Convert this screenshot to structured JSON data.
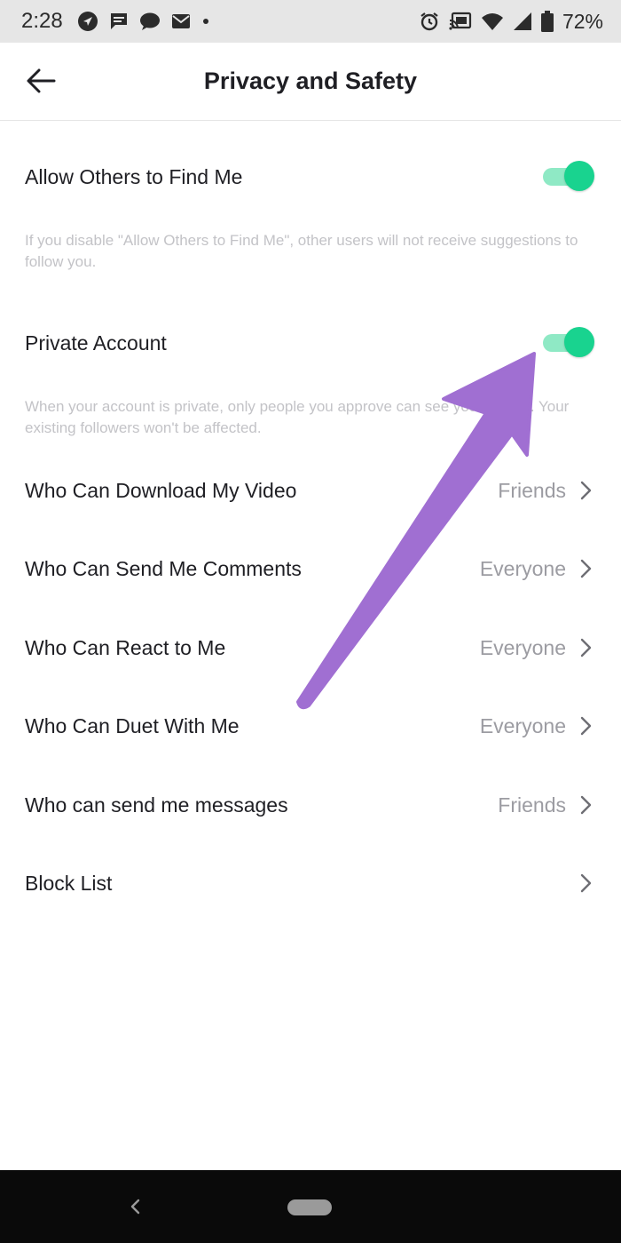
{
  "status_bar": {
    "time": "2:28",
    "battery_percent": "72%",
    "left_icons": [
      "navigation-icon",
      "message-icon",
      "chat-icon",
      "mail-icon",
      "dot-icon"
    ],
    "right_icons": [
      "alarm-icon",
      "cast-icon",
      "wifi-icon",
      "signal-icon",
      "battery-icon"
    ]
  },
  "header": {
    "title": "Privacy and Safety",
    "back_icon": "arrow-left-icon"
  },
  "settings": {
    "allow_find": {
      "label": "Allow Others to Find Me",
      "enabled": true,
      "help": "If you disable \"Allow Others to Find Me\", other users will not receive suggestions to follow you."
    },
    "private_account": {
      "label": "Private Account",
      "enabled": true,
      "help": "When your account is private, only people you approve can see your videos. Your existing followers won't be affected."
    },
    "nav_rows": [
      {
        "label": "Who Can Download My Video",
        "value": "Friends"
      },
      {
        "label": "Who Can Send Me Comments",
        "value": "Everyone"
      },
      {
        "label": "Who Can React to Me",
        "value": "Everyone"
      },
      {
        "label": "Who Can Duet With Me",
        "value": "Everyone"
      },
      {
        "label": "Who can send me messages",
        "value": "Friends"
      },
      {
        "label": "Block List",
        "value": ""
      }
    ]
  },
  "colors": {
    "toggle_on_track": "#8fe9c5",
    "toggle_on_knob": "#19d38f",
    "annotation_arrow": "#a06fd2",
    "helper_text": "#c3c3c7",
    "value_text": "#9c9ca2"
  }
}
